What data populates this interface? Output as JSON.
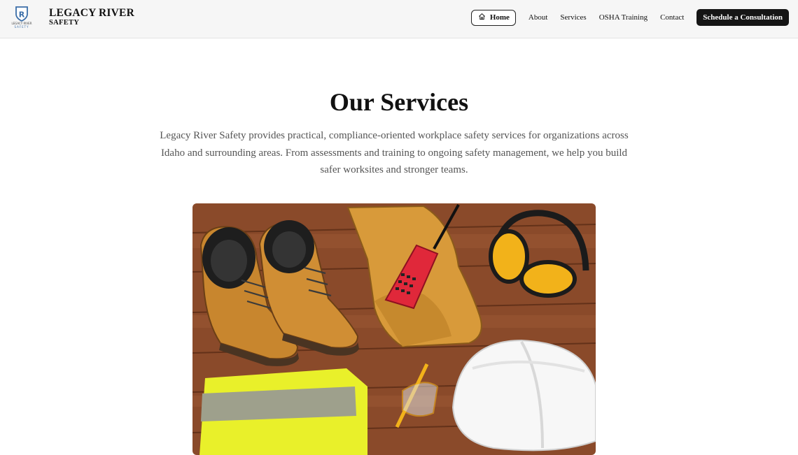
{
  "header": {
    "logo_icon": "shield-r-logo-icon",
    "logo_text": "LEGACY RIVER SAFETY",
    "brand_line1": "LEGACY RIVER",
    "brand_line2": "SAFETY"
  },
  "nav": {
    "home_icon": "home-icon",
    "home": "Home",
    "about": "About",
    "services": "Services",
    "osha": "OSHA Training",
    "contact": "Contact",
    "cta": "Schedule a Consultation"
  },
  "main": {
    "title": "Our Services",
    "intro": "Legacy River Safety provides practical, compliance-oriented workplace safety services for organizations across Idaho and surrounding areas. From assessments and training to ongoing safety management, we help you build safer worksites and stronger teams."
  },
  "hero_image": {
    "subject": "safety-gear-photo",
    "colors": {
      "wood": "#8a4a2a",
      "boot": "#c8862e",
      "glove": "#d89a3a",
      "radio": "#e0283a",
      "earmuff": "#f2b21a",
      "vest": "#e9f02a",
      "helmet": "#f7f7f7"
    }
  }
}
